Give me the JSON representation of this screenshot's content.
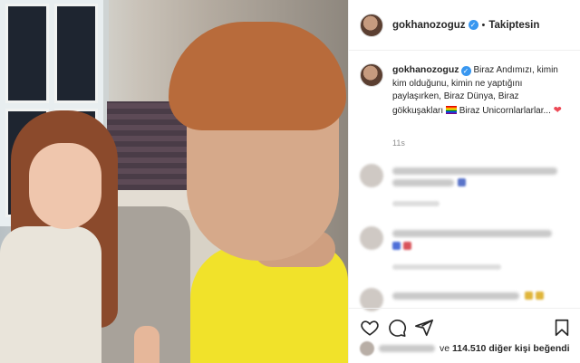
{
  "post": {
    "username": "gokhanozoguz",
    "separator": "•",
    "follow_label": "Takiptesin",
    "caption_text_1": "Biraz Andımızı, kimin kim olduğunu, kimin ne yaptığını paylaşırken, Biraz Dünya, Biraz gökkuşakları",
    "caption_text_2": "Biraz Unicornlarlarlar...",
    "caption_heart": "❤",
    "timestamp": "11s"
  },
  "likes": {
    "connector": "ve",
    "count": "114.510",
    "suffix": "diğer kişi beğendi"
  },
  "icons": [
    "verified-badge-icon",
    "heart-icon",
    "comment-icon",
    "share-icon",
    "bookmark-icon",
    "rainbow-flag-icon"
  ],
  "colors": {
    "verified": "#3897f0",
    "heart_emoji": "#ed4956",
    "meta_gray": "#8e8e8e",
    "text": "#262626",
    "divider": "#efefef"
  }
}
